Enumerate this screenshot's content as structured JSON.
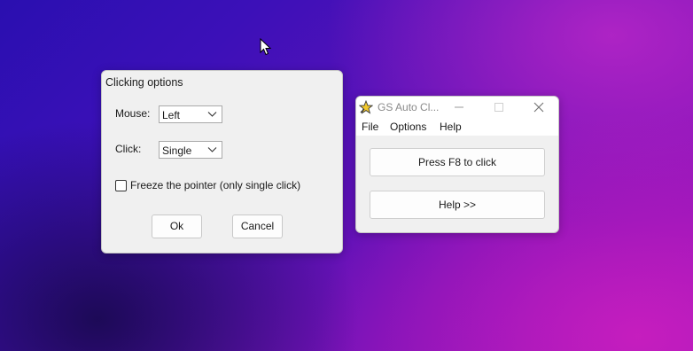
{
  "desktop": {
    "pointer_icon": "mouse-pointer-icon"
  },
  "options_dialog": {
    "title": "Clicking options",
    "mouse_label": "Mouse:",
    "mouse_value": "Left",
    "click_label": "Click:",
    "click_value": "Single",
    "freeze_label": "Freeze the pointer (only single click)",
    "freeze_checked": false,
    "ok_label": "Ok",
    "cancel_label": "Cancel"
  },
  "gs_window": {
    "title": "GS Auto Cl...",
    "icon": "star-icon",
    "menu": [
      "File",
      "Options",
      "Help"
    ],
    "primary_button": "Press F8 to click",
    "help_button": "Help >>"
  },
  "colors": {
    "desktop_blue": "#2a0fb0",
    "desktop_magenta": "#c81ebe",
    "dialog_bg": "#f0f0f0"
  }
}
